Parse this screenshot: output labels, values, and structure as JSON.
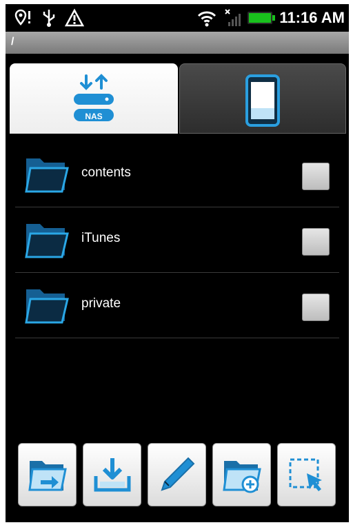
{
  "status_bar": {
    "time": "11:16 AM",
    "icons": [
      "location-alert-icon",
      "usb-icon",
      "warning-icon",
      "wifi-icon",
      "no-signal-icon",
      "battery-icon"
    ]
  },
  "path_bar": {
    "path": "/"
  },
  "tabs": [
    {
      "icon": "nas-icon",
      "label": "NAS",
      "selected": true
    },
    {
      "icon": "phone-icon",
      "label": "",
      "selected": false
    }
  ],
  "files": [
    {
      "name": "contents",
      "checked": false
    },
    {
      "name": "iTunes",
      "checked": false
    },
    {
      "name": "private",
      "checked": false
    }
  ],
  "toolbar": {
    "buttons": [
      "move-icon",
      "download-icon",
      "rename-pencil-icon",
      "new-folder-icon",
      "select-icon"
    ]
  },
  "colors": {
    "accent": "#1f8fd4",
    "accent_dark": "#1a6fa8",
    "background": "#000000"
  }
}
